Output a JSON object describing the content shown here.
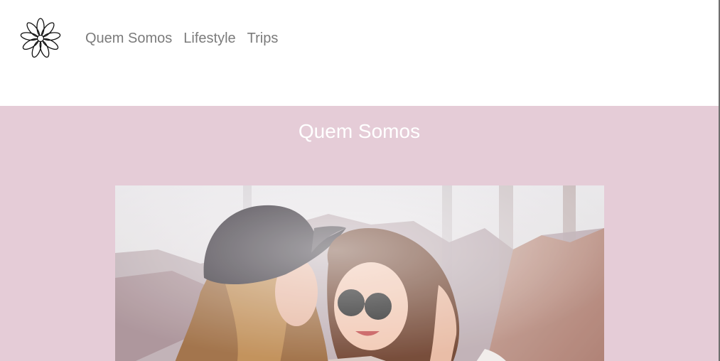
{
  "header": {
    "logo_icon": "flower-icon",
    "nav": [
      {
        "label": "Quem Somos"
      },
      {
        "label": "Lifestyle"
      },
      {
        "label": "Trips"
      }
    ]
  },
  "hero": {
    "title": "Quem Somos",
    "background_color": "#e5ccd7",
    "photo_description_icon": "photo-two-women-icon"
  },
  "colors": {
    "nav_text": "#7b7b7b",
    "hero_bg": "#e5ccd7",
    "hero_title": "#ffffff"
  }
}
